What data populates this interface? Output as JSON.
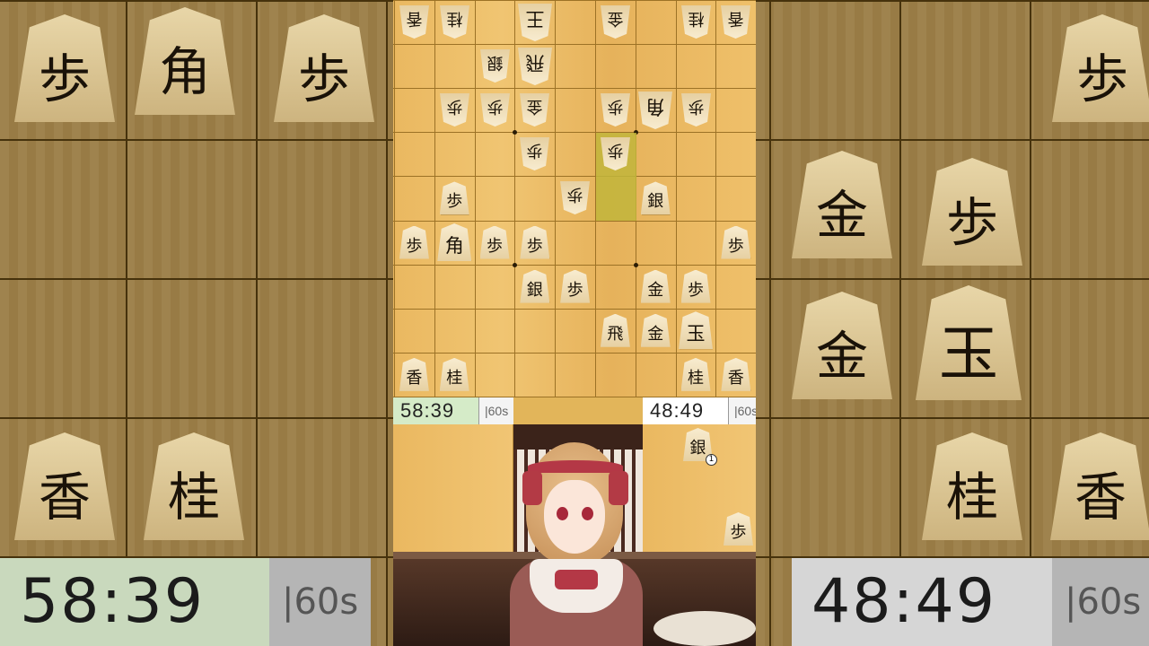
{
  "game": {
    "sente_time": "58:39",
    "gote_time": "48:49",
    "byoyomi": "|60s",
    "gote_hand": [
      {
        "piece": "銀",
        "count": "1"
      },
      {
        "piece": "歩",
        "count": ""
      }
    ],
    "highlight_color": "#c1b53b",
    "board_color": "#eab860"
  },
  "board": {
    "pieces": [
      {
        "row": 0,
        "col": 0,
        "char": "香",
        "side": "gote"
      },
      {
        "row": 0,
        "col": 1,
        "char": "桂",
        "side": "gote"
      },
      {
        "row": 0,
        "col": 3,
        "char": "王",
        "side": "gote",
        "big": true
      },
      {
        "row": 0,
        "col": 5,
        "char": "金",
        "side": "gote"
      },
      {
        "row": 0,
        "col": 7,
        "char": "桂",
        "side": "gote"
      },
      {
        "row": 0,
        "col": 8,
        "char": "香",
        "side": "gote"
      },
      {
        "row": 1,
        "col": 2,
        "char": "銀",
        "side": "gote"
      },
      {
        "row": 1,
        "col": 3,
        "char": "飛",
        "side": "gote",
        "big": true
      },
      {
        "row": 2,
        "col": 1,
        "char": "歩",
        "side": "gote"
      },
      {
        "row": 2,
        "col": 2,
        "char": "歩",
        "side": "gote"
      },
      {
        "row": 2,
        "col": 3,
        "char": "金",
        "side": "gote"
      },
      {
        "row": 2,
        "col": 5,
        "char": "歩",
        "side": "gote"
      },
      {
        "row": 2,
        "col": 6,
        "char": "角",
        "side": "gote",
        "big": true
      },
      {
        "row": 2,
        "col": 7,
        "char": "歩",
        "side": "gote"
      },
      {
        "row": 3,
        "col": 3,
        "char": "歩",
        "side": "gote"
      },
      {
        "row": 3,
        "col": 5,
        "char": "歩",
        "side": "gote"
      },
      {
        "row": 4,
        "col": 1,
        "char": "歩",
        "side": "sente"
      },
      {
        "row": 4,
        "col": 4,
        "char": "歩",
        "side": "gote"
      },
      {
        "row": 4,
        "col": 6,
        "char": "銀",
        "side": "sente"
      },
      {
        "row": 5,
        "col": 0,
        "char": "歩",
        "side": "sente"
      },
      {
        "row": 5,
        "col": 1,
        "char": "角",
        "side": "sente",
        "big": true
      },
      {
        "row": 5,
        "col": 2,
        "char": "歩",
        "side": "sente"
      },
      {
        "row": 5,
        "col": 3,
        "char": "歩",
        "side": "sente"
      },
      {
        "row": 5,
        "col": 8,
        "char": "歩",
        "side": "sente"
      },
      {
        "row": 6,
        "col": 3,
        "char": "銀",
        "side": "sente"
      },
      {
        "row": 6,
        "col": 4,
        "char": "歩",
        "side": "sente"
      },
      {
        "row": 6,
        "col": 6,
        "char": "金",
        "side": "sente"
      },
      {
        "row": 6,
        "col": 7,
        "char": "歩",
        "side": "sente"
      },
      {
        "row": 7,
        "col": 5,
        "char": "飛",
        "side": "sente"
      },
      {
        "row": 7,
        "col": 6,
        "char": "金",
        "side": "sente"
      },
      {
        "row": 7,
        "col": 7,
        "char": "玉",
        "side": "sente",
        "big": true
      },
      {
        "row": 8,
        "col": 0,
        "char": "香",
        "side": "sente"
      },
      {
        "row": 8,
        "col": 1,
        "char": "桂",
        "side": "sente"
      },
      {
        "row": 8,
        "col": 7,
        "char": "桂",
        "side": "sente"
      },
      {
        "row": 8,
        "col": 8,
        "char": "香",
        "side": "sente"
      }
    ],
    "highlights": [
      {
        "row": 3,
        "col": 5
      },
      {
        "row": 4,
        "col": 5
      }
    ]
  },
  "backdrop": {
    "left_pieces": [
      {
        "char": "歩"
      },
      {
        "char": "角"
      },
      {
        "char": "歩"
      },
      {
        "char": "香"
      },
      {
        "char": "桂"
      }
    ],
    "right_pieces": [
      {
        "char": "歩"
      },
      {
        "char": "金"
      },
      {
        "char": "歩"
      },
      {
        "char": "金"
      },
      {
        "char": "玉"
      },
      {
        "char": "桂"
      },
      {
        "char": "香"
      }
    ]
  }
}
